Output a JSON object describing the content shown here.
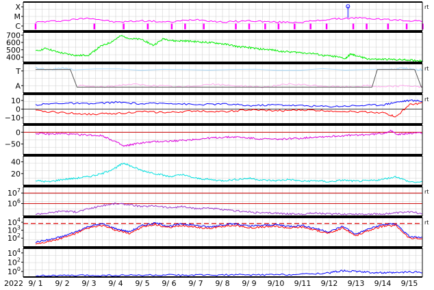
{
  "chart_data": {
    "type": "line",
    "year_label": "2022",
    "x_days": [
      "9/ 1",
      "9/ 2",
      "9/ 3",
      "9/ 4",
      "9/ 5",
      "9/ 6",
      "9/ 7",
      "9/ 8",
      "9/ 9",
      "9/10",
      "9/11",
      "9/12",
      "9/13",
      "9/14",
      "9/15"
    ],
    "grid": true,
    "side_label": "rt",
    "panels": [
      {
        "id": "xmc",
        "y_tick_labels": [
          "X",
          "M",
          "C"
        ],
        "series": [
          {
            "color": "#ff00ff",
            "x": [
              0,
              1,
              2,
              3,
              4,
              5,
              6,
              7,
              8,
              9,
              10,
              11,
              12,
              13,
              14,
              14.7
            ],
            "y": [
              0.3,
              0.35,
              0.45,
              0.3,
              0.35,
              0.3,
              0.4,
              0.3,
              0.35,
              0.3,
              0.3,
              0.4,
              0.45,
              0.4,
              0.35,
              0.35
            ]
          }
        ],
        "marker_day": 11.7
      },
      {
        "id": "wind_speed",
        "y_tick_labels": [
          "700",
          "600",
          "500",
          "400"
        ],
        "y_ticks": [
          700,
          600,
          500,
          400
        ],
        "ylim": [
          330,
          740
        ],
        "series": [
          {
            "color": "#00ee00",
            "x": [
              0,
              0.4,
              0.8,
              1.2,
              1.6,
              2.0,
              2.4,
              2.8,
              3.2,
              3.6,
              4.0,
              4.4,
              4.8,
              5.2,
              5.6,
              6.0,
              6.4,
              6.8,
              7.2,
              7.6,
              8.0,
              8.4,
              8.8,
              9.2,
              9.6,
              10.0,
              10.4,
              10.8,
              11.2,
              11.6,
              11.8,
              12.0,
              12.4,
              12.8,
              13.2,
              13.6,
              14.0,
              14.4,
              14.7
            ],
            "y": [
              480,
              520,
              470,
              440,
              420,
              430,
              540,
              600,
              690,
              650,
              640,
              560,
              650,
              620,
              620,
              610,
              600,
              590,
              570,
              540,
              530,
              510,
              500,
              480,
              470,
              460,
              450,
              420,
              410,
              380,
              440,
              420,
              380,
              370,
              370,
              365,
              360,
              350,
              355
            ]
          }
        ]
      },
      {
        "id": "ta",
        "y_tick_labels": [
          "T",
          "A"
        ],
        "series": [
          {
            "color": "#aaddff",
            "x": [
              0,
              0.5,
              1.0,
              1.4,
              13.3,
              13.8,
              14.2,
              14.7
            ],
            "y": [
              0.85,
              0.8,
              0.85,
              0.8,
              0.8,
              0.85,
              0.8,
              0.8
            ]
          },
          {
            "color": "#ffaaee",
            "x": [
              1.6,
              2.5,
              3.5,
              4.5,
              5.5,
              6.5,
              7.5,
              8.5,
              9.5,
              10.5,
              11.5,
              12.5,
              13.0,
              13.9,
              14.5
            ],
            "y": [
              0.25,
              0.2,
              0.3,
              0.25,
              0.2,
              0.3,
              0.25,
              0.2,
              0.3,
              0.25,
              0.2,
              0.25,
              0.2,
              0.25,
              0.2
            ]
          },
          {
            "color": "#555555",
            "x": [
              0,
              1.3,
              1.55,
              12.6,
              12.8,
              14.2,
              14.45,
              14.7
            ],
            "y": [
              0.8,
              0.8,
              0.2,
              0.2,
              0.8,
              0.8,
              0.2,
              0.2
            ]
          }
        ]
      },
      {
        "id": "bfield",
        "y_tick_labels": [
          "10",
          "0",
          "−10"
        ],
        "y_ticks": [
          10,
          0,
          -10
        ],
        "ylim": [
          -17,
          17
        ],
        "series": [
          {
            "color": "#0000ff",
            "x": [
              0,
              1,
              2,
              3,
              4,
              5,
              6,
              7,
              8,
              9,
              10,
              11,
              12,
              13,
              13.5,
              14,
              14.7
            ],
            "y": [
              5,
              7,
              6,
              8,
              6,
              7,
              5,
              6,
              4,
              5,
              4,
              3,
              4,
              5,
              8,
              10,
              9
            ]
          },
          {
            "color": "#ff0000",
            "x": [
              0,
              1,
              2,
              3,
              4,
              5,
              6,
              7,
              8,
              9,
              10,
              11,
              12,
              13,
              13.5,
              14,
              14.7
            ],
            "y": [
              -2,
              -4,
              -6,
              -5,
              -3,
              -4,
              -2,
              -3,
              -1,
              -2,
              -1,
              -2,
              -3,
              -4,
              -9,
              5,
              8
            ]
          }
        ]
      },
      {
        "id": "dst",
        "y_tick_labels": [
          "0",
          "−50"
        ],
        "y_ticks": [
          0,
          -50
        ],
        "ylim": [
          -95,
          30
        ],
        "series": [
          {
            "color": "#dd00dd",
            "x": [
              0,
              0.5,
              1,
              1.5,
              2,
              2.5,
              3,
              3.3,
              3.6,
              4,
              4.5,
              5,
              5.5,
              6,
              6.5,
              7,
              7.5,
              8,
              8.5,
              9,
              9.5,
              10,
              10.5,
              11,
              11.5,
              12,
              12.5,
              13,
              13.3,
              13.6,
              14,
              14.7
            ],
            "y": [
              -5,
              -8,
              -6,
              -10,
              -12,
              -15,
              -40,
              -60,
              -52,
              -45,
              -40,
              -38,
              -35,
              -30,
              -25,
              -22,
              -20,
              -25,
              -28,
              -30,
              -27,
              -25,
              -20,
              -18,
              -15,
              -12,
              -10,
              -5,
              5,
              -10,
              -5,
              -3
            ]
          }
        ]
      },
      {
        "id": "kp",
        "y_tick_labels": [
          "40",
          "20"
        ],
        "y_ticks": [
          40,
          20
        ],
        "ylim": [
          0,
          50
        ],
        "series": [
          {
            "color": "#00e0e0",
            "x": [
              0,
              0.5,
              1,
              1.5,
              2,
              2.5,
              3,
              3.3,
              3.6,
              4,
              4.5,
              5,
              5.5,
              6,
              6.5,
              7,
              7.5,
              8,
              8.5,
              9,
              9.5,
              10,
              10.5,
              11,
              11.5,
              12,
              12.5,
              13,
              13.5,
              14,
              14.7
            ],
            "y": [
              8,
              6,
              10,
              12,
              15,
              20,
              30,
              38,
              32,
              25,
              20,
              15,
              18,
              12,
              10,
              8,
              10,
              12,
              9,
              8,
              10,
              7,
              8,
              6,
              9,
              7,
              8,
              10,
              15,
              6,
              5
            ]
          }
        ]
      },
      {
        "id": "proton",
        "y_tick_labels": [
          "10^7",
          "10^6"
        ],
        "y_ticks": [
          7,
          6
        ],
        "ylim": [
          4.8,
          7.6
        ],
        "ref_lines": [
          7,
          6
        ],
        "series": [
          {
            "color": "#9933cc",
            "x": [
              0,
              0.5,
              1,
              1.5,
              2,
              2.5,
              3,
              3.5,
              4,
              4.5,
              5,
              5.5,
              6,
              6.5,
              7,
              7.5,
              8,
              8.5,
              9,
              9.5,
              10,
              10.5,
              11,
              11.5,
              12,
              12.5,
              13,
              13.5,
              14,
              14.7
            ],
            "y": [
              5.0,
              5.1,
              5.3,
              5.2,
              5.5,
              5.8,
              6.0,
              5.9,
              5.7,
              5.8,
              5.6,
              5.7,
              5.5,
              5.6,
              5.4,
              5.3,
              5.2,
              5.1,
              5.1,
              5.0,
              5.0,
              5.1,
              5.0,
              5.0,
              5.0,
              5.0,
              5.0,
              5.1,
              5.2,
              5.0
            ]
          }
        ]
      },
      {
        "id": "electron",
        "y_tick_labels": [
          "10^4",
          "10^3",
          "10^2"
        ],
        "y_ticks": [
          4,
          3,
          2
        ],
        "ylim": [
          0.9,
          4.6
        ],
        "threshold": 3.85,
        "series": [
          {
            "color": "#0000ff",
            "x": [
              0,
              0.5,
              1,
              1.5,
              2,
              2.5,
              3,
              3.5,
              4,
              4.5,
              5,
              5.5,
              6,
              6.5,
              7,
              7.5,
              8,
              8.5,
              9,
              9.5,
              10,
              10.5,
              11,
              11.5,
              12,
              12.5,
              13,
              13.5,
              14,
              14.7
            ],
            "y": [
              1.5,
              1.8,
              2.2,
              2.8,
              3.5,
              3.8,
              3.2,
              2.8,
              3.6,
              3.9,
              3.5,
              3.8,
              3.6,
              3.4,
              3.7,
              3.8,
              3.5,
              3.6,
              3.7,
              3.5,
              3.6,
              3.2,
              2.8,
              3.5,
              2.5,
              3.2,
              3.7,
              3.8,
              2.2,
              2.0
            ]
          },
          {
            "color": "#ff0000",
            "x": [
              0,
              0.5,
              1,
              1.5,
              2,
              2.5,
              3,
              3.5,
              4,
              4.5,
              5,
              5.5,
              6,
              6.5,
              7,
              7.5,
              8,
              8.5,
              9,
              9.5,
              10,
              10.5,
              11,
              11.5,
              12,
              12.5,
              13,
              13.5,
              14,
              14.7
            ],
            "y": [
              1.3,
              1.6,
              2.0,
              2.6,
              3.3,
              3.6,
              3.0,
              2.6,
              3.4,
              3.7,
              3.3,
              3.6,
              3.4,
              3.2,
              3.5,
              3.6,
              3.3,
              3.4,
              3.5,
              3.3,
              3.4,
              3.0,
              2.6,
              3.3,
              2.3,
              3.0,
              3.5,
              3.6,
              2.0,
              1.9
            ]
          }
        ]
      },
      {
        "id": "flux",
        "y_tick_labels": [
          "10^4",
          "10^2",
          "10^0"
        ],
        "y_ticks": [
          4,
          2,
          0
        ],
        "ylim": [
          -1.2,
          5
        ],
        "series": [
          {
            "color": "#0000ff",
            "x": [
              0,
              1,
              2,
              3,
              4,
              5,
              6,
              7,
              8,
              9,
              10,
              11,
              11.5,
              12,
              12.5,
              13,
              13.5,
              14,
              14.7
            ],
            "y": [
              -0.9,
              -0.9,
              -0.85,
              -0.85,
              -0.8,
              -0.8,
              -0.8,
              -0.75,
              -0.75,
              -0.7,
              -0.6,
              -0.3,
              0.2,
              0.0,
              -0.2,
              -0.3,
              -0.3,
              -0.1,
              -0.2
            ]
          }
        ]
      }
    ]
  }
}
